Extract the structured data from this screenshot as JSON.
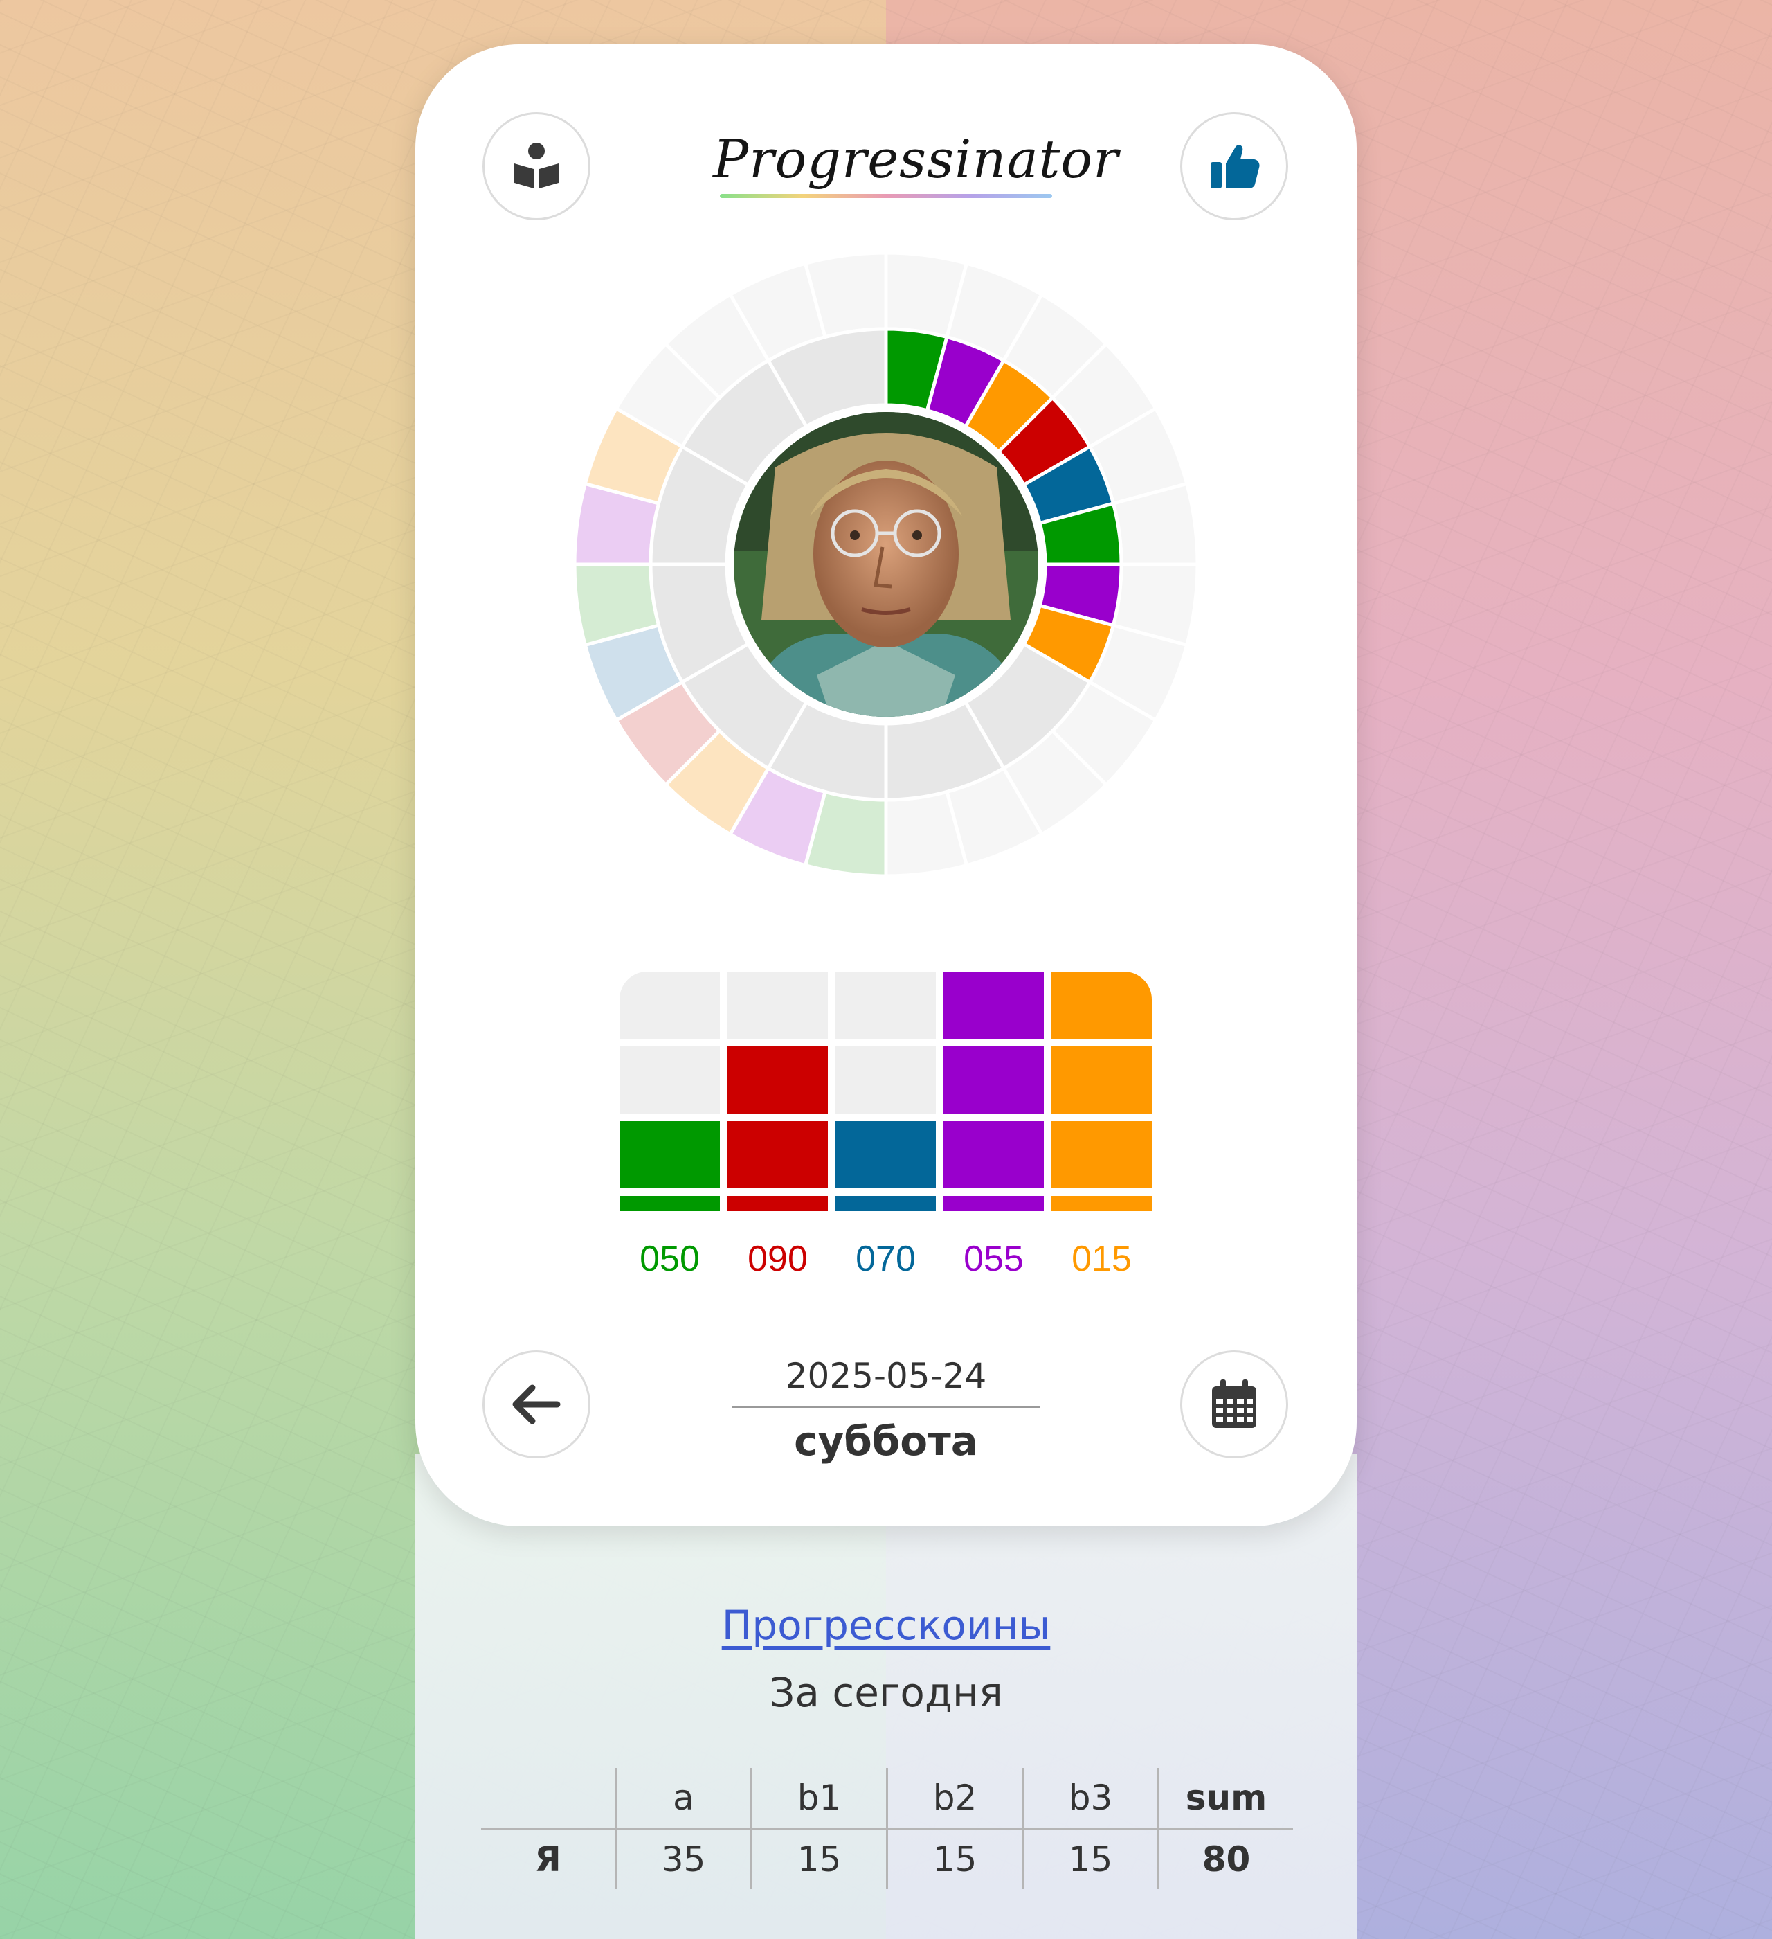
{
  "app": {
    "title": "Progressinator"
  },
  "header": {
    "left_icon": "book-reader-icon",
    "right_icon": "thumbs-up-icon"
  },
  "colors": {
    "green": "#009900",
    "red": "#cc0000",
    "blue": "#036799",
    "purple": "#9900cc",
    "orange": "#ff9900",
    "empty": "#efefef"
  },
  "bars": [
    {
      "value": "050",
      "color": "#009900",
      "filled_blocks": 1,
      "total_blocks": 3
    },
    {
      "value": "090",
      "color": "#cc0000",
      "filled_blocks": 2,
      "total_blocks": 3
    },
    {
      "value": "070",
      "color": "#036799",
      "filled_blocks": 1,
      "total_blocks": 3
    },
    {
      "value": "055",
      "color": "#9900cc",
      "filled_blocks": 3,
      "total_blocks": 3
    },
    {
      "value": "015",
      "color": "#ff9900",
      "filled_blocks": 3,
      "total_blocks": 3
    }
  ],
  "footer_nav": {
    "date": "2025-05-24",
    "weekday": "суббота",
    "back_icon": "arrow-left-icon",
    "calendar_icon": "calendar-icon"
  },
  "coins": {
    "link_label": "Прогресскоины",
    "subtitle": "За сегодня",
    "columns": [
      "",
      "a",
      "b1",
      "b2",
      "b3",
      "sum"
    ],
    "rows": [
      {
        "name": "Я",
        "a": "35",
        "b1": "15",
        "b2": "15",
        "b3": "15",
        "sum": "80"
      }
    ]
  }
}
